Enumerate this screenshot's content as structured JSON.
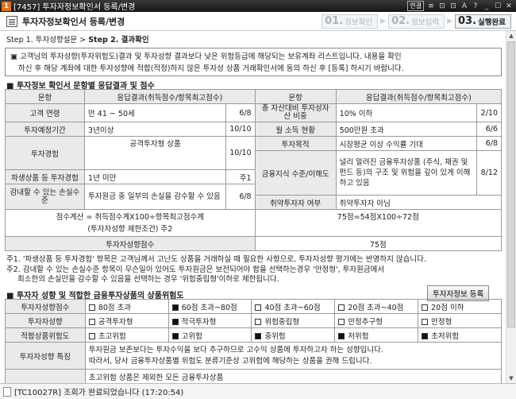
{
  "window": {
    "badge": "1",
    "title": "[7457] 투자자정보확인서 등록/변경",
    "controls": [
      "≡",
      "⊡",
      "⊡",
      "A",
      "?",
      "_",
      "☐",
      "✕"
    ],
    "pin_label": "연결"
  },
  "header": {
    "title": "투자자정보확인서 등록/변경",
    "steps": [
      {
        "num": "01.",
        "label": "정보확인",
        "active": false
      },
      {
        "num": "02.",
        "label": "정보입력",
        "active": false
      },
      {
        "num": "03.",
        "label": "실행완료",
        "active": true
      }
    ]
  },
  "breadcrumb": {
    "step1": "Step 1. 투자성향설문",
    "sep": " > ",
    "step2": "Step 2. 결과확인"
  },
  "notice": {
    "line1": "▣ 고객님의 투자성향(투자위험도)결과 및 투자성향 결과보다 낮은 위험등급에 해당되는 보유계좌 리스트입니다. 내용을 확인",
    "line2": "하신 후 해당 계좌에 대한 투자성향에 적합(적정)하지 않은 투자성 상품 거래확인서에 동의 하신 후 [등록] 하시기 바랍니다."
  },
  "section1": {
    "title": "투자정보 확인서 문항별 응답결과 및 점수",
    "col_headers": [
      "문항",
      "응답결과(취득점수/항목최고점수)",
      "문항",
      "응답결과(취득점수/항목최고점수)"
    ],
    "left_rows": [
      {
        "item": "고객 연령",
        "answer": "만 41 ~ 50세",
        "score": "6/8"
      },
      {
        "item": "투자예정기간",
        "answer": "3년이상",
        "score": "10/10"
      },
      {
        "item": "투자경험",
        "answer": "공격투자형 상품",
        "score": "10/10"
      },
      {
        "item": "파생상품 등 투자경험",
        "answer": "1년 미만",
        "score": "주1"
      },
      {
        "item": "감내할 수 있는 손실수준",
        "answer": "투자원금 중 일부의 손실을 감수할 수 있음",
        "score": "6/8"
      }
    ],
    "right_rows": [
      {
        "item": "총 자산대비 투자성자산 비중",
        "answer": "10% 이하",
        "score": "2/10"
      },
      {
        "item": "월 소득 현황",
        "answer": "500만원 초과",
        "score": "6/6"
      },
      {
        "item": "투자목적",
        "answer": "시장평균 이상 수익률 기대",
        "score": "6/8"
      },
      {
        "item": "금융지식 수준/이해도",
        "answer": "널리 알려진 금융투자상품 (주식, 채권 및 펀드 등)의 구조 및 위험을 깊이 있게 이해하고 있음",
        "score": "8/12"
      },
      {
        "item": "취약투자자 여부",
        "answer": "취약투자자 아님",
        "score": ""
      }
    ],
    "calc_label_1": "점수계산 = 취득점수계X100÷항목최고점수계",
    "calc_label_2": "(투자자성향 제한조건) 주2",
    "calc_value": "75점=54점X100÷72점",
    "score_label": "투자자성향점수",
    "score_value": "75점"
  },
  "notes": {
    "n1": "주1. '파생상품 등 투자경험' 항목은 고객님께서 고난도 상품을 거래하실 때 필요한 사항으로, 투자자성향 평가에는 반영하지 않습니다.",
    "n2a": "주2. 감내할 수 있는 손실수준 항목이 무슨일이 있어도 투자원금은 보전되어야 함을 선택하는경우 '안정형', 투자원금에서",
    "n2b": "최소한의 손실만을 감수할 수 있음을 선택하는 경우 '위험중립형'이하로 제한됩니다."
  },
  "section2": {
    "title": "투자자 성향 및 적합한 금융투자상품의 상품위험도",
    "register_button": "투자자정보 등록",
    "score_row": {
      "label": "투자자성향점수",
      "options": [
        {
          "text": "80점 초과",
          "checked": false
        },
        {
          "text": "60점 초과~80점",
          "checked": true
        },
        {
          "text": "40점 초과~60점",
          "checked": false
        },
        {
          "text": "20점 초과~40점",
          "checked": false
        },
        {
          "text": "20점 이하",
          "checked": false
        }
      ]
    },
    "type_row": {
      "label": "투자자성향",
      "options": [
        {
          "text": "공격투자형",
          "checked": false
        },
        {
          "text": "적극투자형",
          "checked": true
        },
        {
          "text": "위험중립형",
          "checked": false
        },
        {
          "text": "안정추구형",
          "checked": false
        },
        {
          "text": "안정형",
          "checked": false
        }
      ]
    },
    "risk_row": {
      "label": "적합상품위험도",
      "options": [
        {
          "text": "초고위험",
          "checked": false
        },
        {
          "text": "고위험",
          "checked": true
        },
        {
          "text": "중위험",
          "checked": true
        },
        {
          "text": "저위험",
          "checked": true
        },
        {
          "text": "초저위험",
          "checked": true
        }
      ]
    },
    "feature_label": "투자자성향 특징",
    "feature_line1": "투자원금 보존보다는 투자수익을 보다 추구하므로 고수익 상품에 투자하고자 하는 성향입니다.",
    "feature_line2": "따라서, 당사 금융투자상품별 위험도 분류기준상 고위험에 해당하는 상품을 권해 드립니다.",
    "feature_line3": "초고위험 상품은 제외한 모든 금융투자상품"
  },
  "status": {
    "text": "[TC10027R] 조회가 완료되었습니다 (17:20:54)"
  }
}
